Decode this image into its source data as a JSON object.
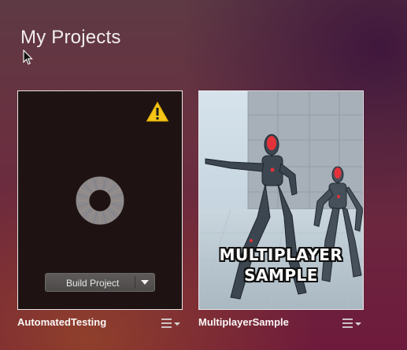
{
  "page": {
    "title": "My Projects"
  },
  "projects": [
    {
      "name": "AutomatedTesting",
      "status_icon": "warning-icon",
      "loading_icon": "loading-ring-icon",
      "build_button_label": "Build Project",
      "menu_icon": "hamburger-menu-icon"
    },
    {
      "name": "MultiplayerSample",
      "thumbnail_caption_line1": "MULTIPLAYER",
      "thumbnail_caption_line2": "SAMPLE",
      "thumbnail_icon": "robot-thumbnail-image",
      "menu_icon": "hamburger-menu-icon"
    }
  ],
  "colors": {
    "warning": "#f5c518",
    "card_border": "#e9e6e8",
    "robot_accent": "#e5323a"
  }
}
